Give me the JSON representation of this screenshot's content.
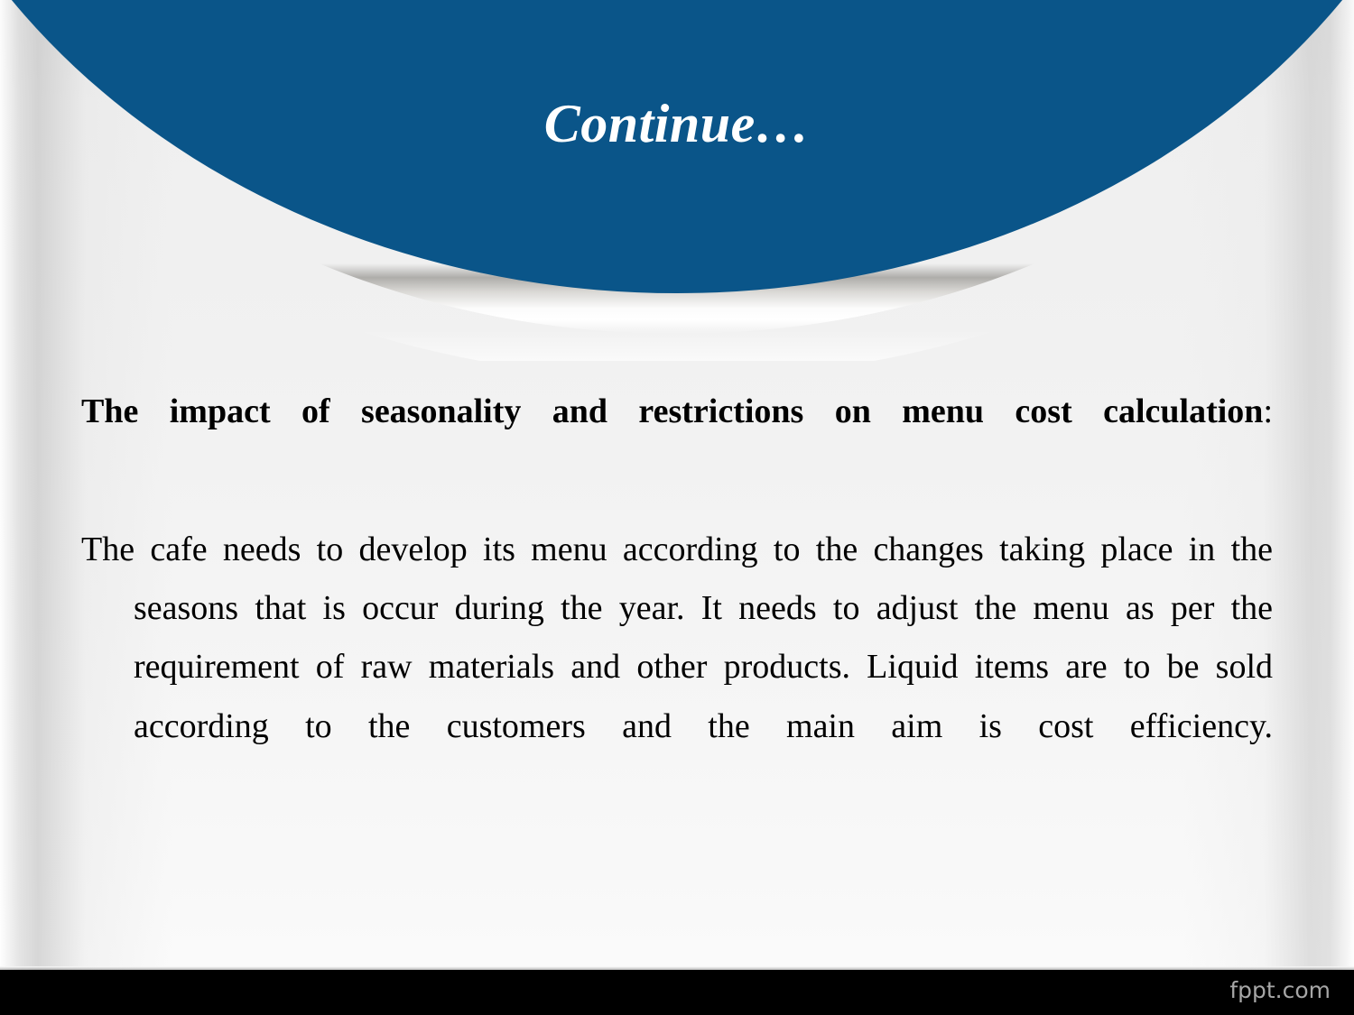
{
  "slide": {
    "title": "Continue…",
    "theme": {
      "header_blue": "#0a5589",
      "body_background": "#f2f2f2",
      "footer_black": "#000000",
      "title_color": "#ffffff",
      "text_color": "#000000",
      "watermark_color": "#a6a6a6"
    }
  },
  "content": {
    "heading": {
      "text": "The impact of seasonality and restrictions on menu cost calculation",
      "trailing_punctuation": ":"
    },
    "paragraph": "The cafe needs to develop its menu according to the changes taking place in the seasons that is occur during the year. It needs to adjust the menu as per the requirement of  raw materials and other products. Liquid items are to be sold according to the customers and the main aim is cost efficiency."
  },
  "footer": {
    "watermark": "fppt.com"
  }
}
